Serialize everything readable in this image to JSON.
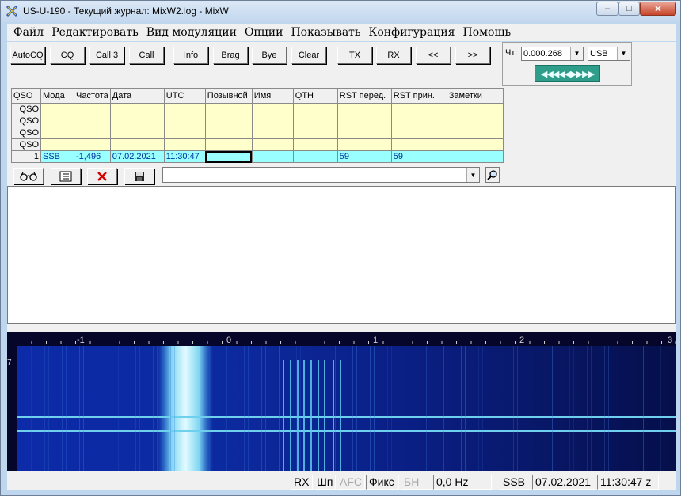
{
  "window": {
    "title": "US-U-190 - Текущий журнал: MixW2.log - MixW",
    "minimize": "–",
    "maximize": "□",
    "close": "✕"
  },
  "menu": [
    "Файл",
    "Редактировать",
    "Вид модуляции",
    "Опции",
    "Показывать",
    "Конфигурация",
    "Помощь"
  ],
  "macro_buttons": [
    "AutoCQ",
    "CQ",
    "Call 3",
    "Call",
    "Info",
    "Brag",
    "Bye",
    "Clear",
    "TX",
    "RX",
    "<<",
    ">>"
  ],
  "freq_panel": {
    "label": "Чт:",
    "frequency": "0.000.268",
    "mode": "USB",
    "tuner": "◀◀◀◀◀▶▶▶▶",
    "dropdown_icon": "▼"
  },
  "log_table": {
    "columns": [
      "QSO",
      "Мода",
      "Частота",
      "Дата",
      "UTC",
      "Позывной",
      "Имя",
      "QTH",
      "RST перед.",
      "RST прин.",
      "Заметки"
    ],
    "empty_rows": [
      "QSO",
      "QSO",
      "QSO",
      "QSO"
    ],
    "current_row": {
      "qso": "1",
      "mode": "SSB",
      "freq": "-1,496",
      "date": "07.02.2021",
      "utc": "11:30:47",
      "call": "",
      "name": "",
      "qth": "",
      "rst_sent": "59",
      "rst_rcvd": "59",
      "notes": ""
    }
  },
  "log_toolbar": [
    "glasses-icon",
    "save-entry-icon",
    "delete-icon",
    "disk-icon"
  ],
  "call_input": {
    "value": ""
  },
  "waterfall": {
    "scale_labels": [
      "-1",
      "0",
      "1",
      "2",
      "3"
    ],
    "level": "7"
  },
  "status": {
    "rx": "RX",
    "shp": "Шп",
    "afc": "AFC",
    "fix": "Фикс",
    "bn": "БН",
    "offset": "0,0 Hz",
    "mode": "SSB",
    "date": "07.02.2021",
    "time": "11:30:47 z"
  },
  "colors": {
    "log_bg": "#ffffcc",
    "current_row": "#99ffff",
    "tuner": "#2e9e8a",
    "waterfall_bg": "#05062a"
  }
}
